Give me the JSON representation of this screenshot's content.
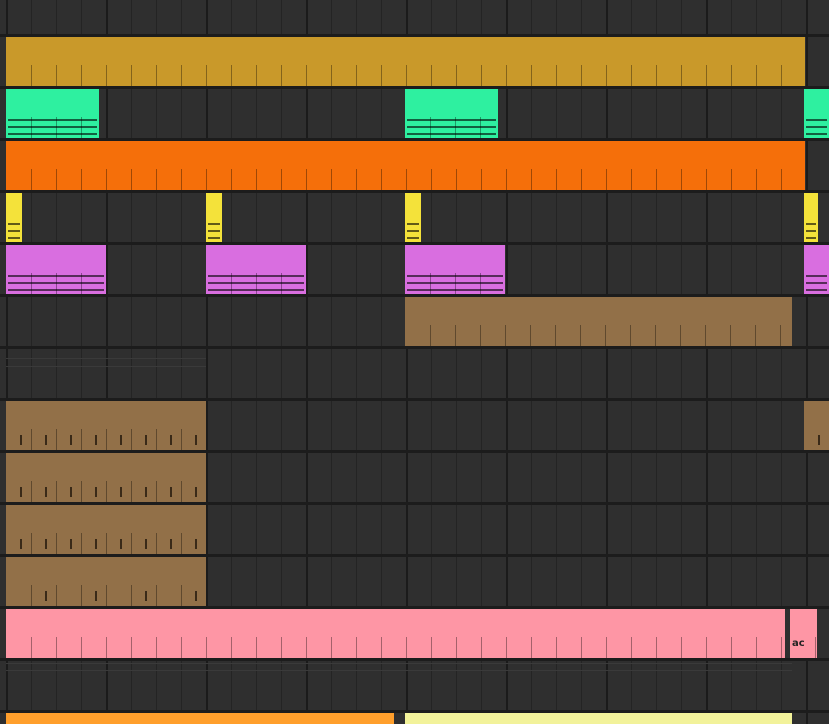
{
  "colors": {
    "background": "#2f2f2f",
    "gold": "#c9992a",
    "green": "#2ef0a0",
    "orange": "#f56f0a",
    "yellow": "#f4e23a",
    "violet": "#d96ee0",
    "brown": "#927048",
    "pink": "#fe96a5",
    "light_orange": "#ff9f2c",
    "pale_yellow": "#f2f29a"
  },
  "clip_labels": {
    "pink_small_clip": "ac"
  }
}
